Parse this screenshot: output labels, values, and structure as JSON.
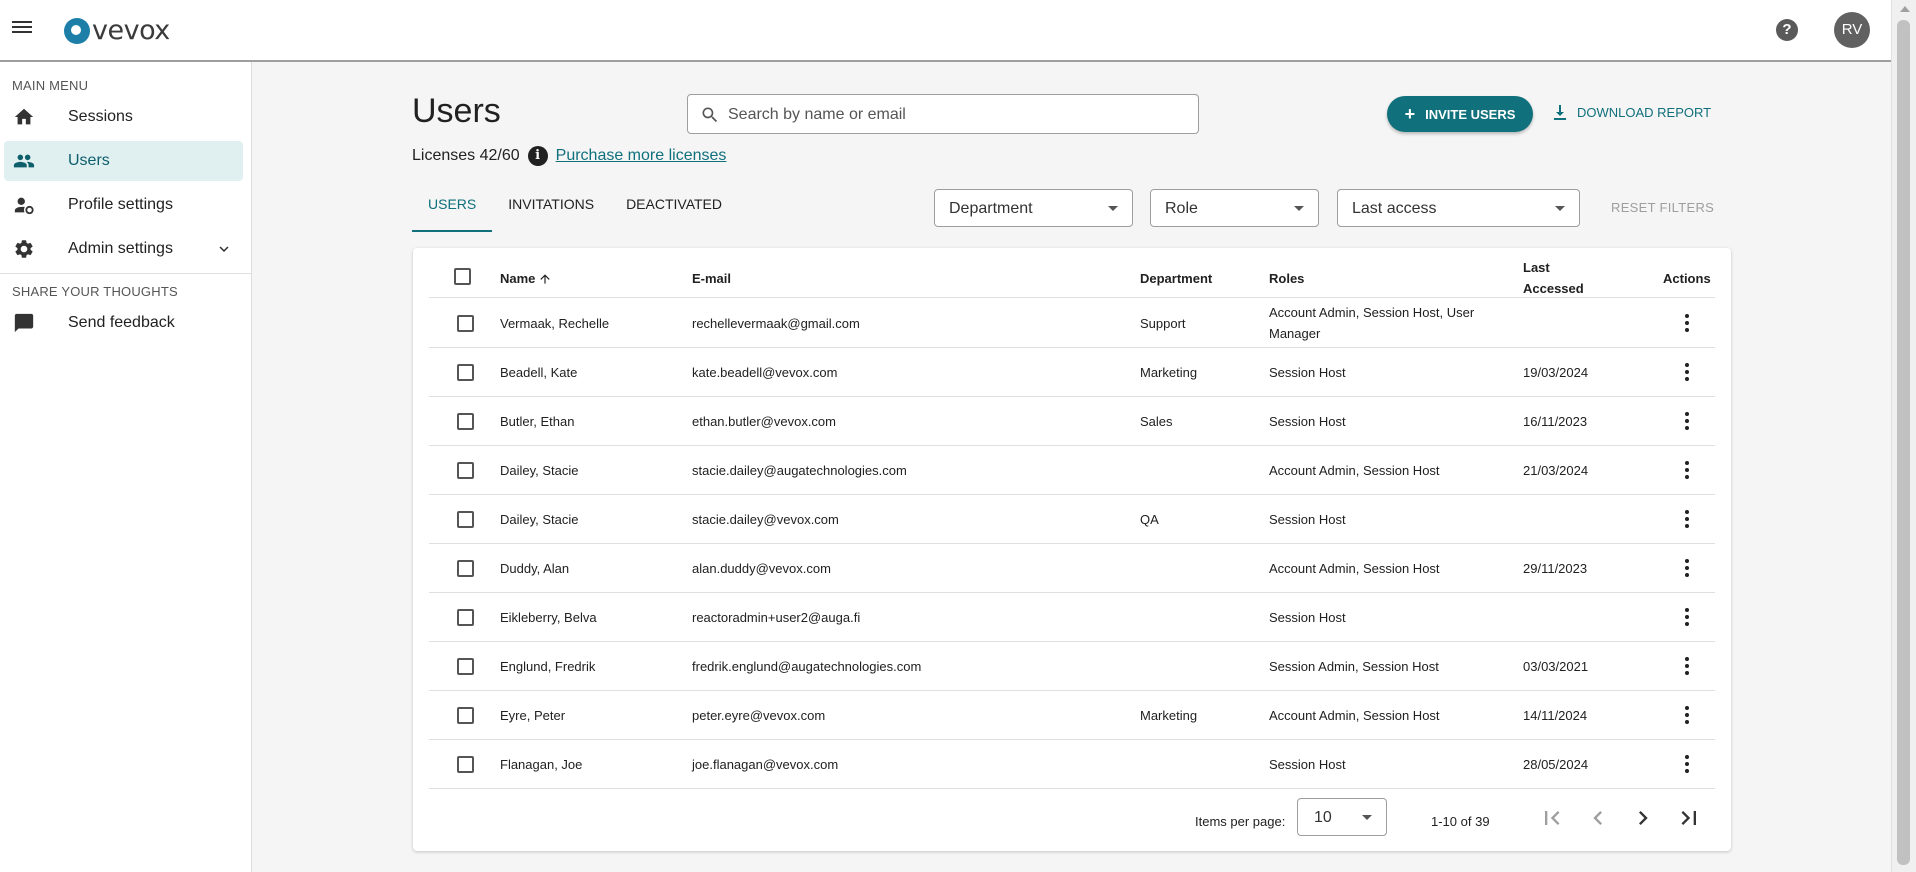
{
  "header": {
    "brand": "vevox",
    "help_icon": "?",
    "avatar_initials": "RV"
  },
  "sidebar": {
    "main_menu_title": "MAIN MENU",
    "items": [
      {
        "label": "Sessions",
        "icon": "home-icon"
      },
      {
        "label": "Users",
        "icon": "users-icon",
        "active": true
      },
      {
        "label": "Profile settings",
        "icon": "profile-settings-icon"
      },
      {
        "label": "Admin settings",
        "icon": "gear-icon"
      }
    ],
    "share_title": "SHARE YOUR THOUGHTS",
    "feedback_label": "Send feedback"
  },
  "main": {
    "title": "Users",
    "search_placeholder": "Search by name or email",
    "invite_label": "INVITE USERS",
    "download_label": "DOWNLOAD REPORT",
    "licenses_text": "Licenses 42/60",
    "info_icon": "i",
    "purchase_link": "Purchase more licenses",
    "tabs": [
      "USERS",
      "INVITATIONS",
      "DEACTIVATED"
    ],
    "filters": {
      "department": "Department",
      "role": "Role",
      "last_access": "Last access",
      "reset": "RESET FILTERS"
    }
  },
  "table": {
    "columns": {
      "name": "Name",
      "email": "E-mail",
      "department": "Department",
      "roles": "Roles",
      "last_accessed_1": "Last",
      "last_accessed_2": "Accessed",
      "actions": "Actions"
    },
    "rows": [
      {
        "name": "Vermaak, Rechelle",
        "email": "rechellevermaak@gmail.com",
        "department": "Support",
        "roles": "Account Admin, Session Host, User",
        "roles2": "Manager",
        "last": ""
      },
      {
        "name": "Beadell, Kate",
        "email": "kate.beadell@vevox.com",
        "department": "Marketing",
        "roles": "Session Host",
        "last": "19/03/2024"
      },
      {
        "name": "Butler, Ethan",
        "email": "ethan.butler@vevox.com",
        "department": "Sales",
        "roles": "Session Host",
        "last": "16/11/2023"
      },
      {
        "name": "Dailey, Stacie",
        "email": "stacie.dailey@augatechnologies.com",
        "department": "",
        "roles": "Account Admin, Session Host",
        "last": "21/03/2024"
      },
      {
        "name": "Dailey, Stacie",
        "email": "stacie.dailey@vevox.com",
        "department": "QA",
        "roles": "Session Host",
        "last": ""
      },
      {
        "name": "Duddy, Alan",
        "email": "alan.duddy@vevox.com",
        "department": "",
        "roles": "Account Admin, Session Host",
        "last": "29/11/2023"
      },
      {
        "name": "Eikleberry, Belva",
        "email": "reactoradmin+user2@auga.fi",
        "department": "",
        "roles": "Session Host",
        "last": ""
      },
      {
        "name": "Englund, Fredrik",
        "email": "fredrik.englund@augatechnologies.com",
        "department": "",
        "roles": "Session Admin, Session Host",
        "last": "03/03/2021"
      },
      {
        "name": "Eyre, Peter",
        "email": "peter.eyre@vevox.com",
        "department": "Marketing",
        "roles": "Account Admin, Session Host",
        "last": "14/11/2024"
      },
      {
        "name": "Flanagan, Joe",
        "email": "joe.flanagan@vevox.com",
        "department": "",
        "roles": "Session Host",
        "last": "28/05/2024"
      }
    ],
    "paginator": {
      "items_per_page_label": "Items per page:",
      "items_per_page": "10",
      "range": "1-10 of 39"
    }
  }
}
